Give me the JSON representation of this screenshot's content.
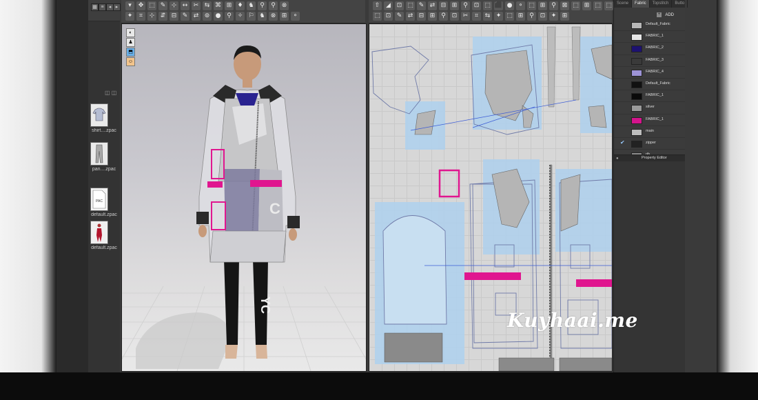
{
  "library": {
    "items": [
      {
        "label": "shirt....zpac",
        "icon": "shirt-thumbnail-icon"
      },
      {
        "label": "pan....zpac",
        "icon": "pants-thumbnail-icon"
      },
      {
        "label": "default.zpac",
        "icon": "document-thumbnail-icon",
        "badge": "PAC"
      },
      {
        "label": "default.zpac",
        "icon": "avatar-thumbnail-icon"
      }
    ]
  },
  "toolbar3d": {
    "row1": [
      "▾",
      "✥",
      "⬚",
      "✎",
      "⊹",
      "↔",
      "✂",
      "⇆",
      "⌘",
      "⊞",
      "♦",
      "♞",
      "⚲",
      "⚲",
      "⊗"
    ],
    "row2": [
      "✦",
      "⌗",
      "⊹",
      "⇵",
      "⊟",
      "✎",
      "⇄",
      "⊚",
      "●",
      "⚲",
      "✧",
      "⚐",
      "♞",
      "⊗",
      "⊞",
      "⚬"
    ]
  },
  "toolbar2d": {
    "row1": [
      "⇧",
      "◢",
      "⊡",
      "⬚",
      "✎",
      "⇄",
      "⊟",
      "⊞",
      "⚲",
      "⊡",
      "⬚",
      "⬛",
      "●",
      "⚬",
      "⬚",
      "⊞",
      "⚲",
      "⊠",
      "⬚",
      "⊞",
      "⬚",
      "⬚"
    ],
    "row2": [
      "⬚",
      "⊡",
      "✎",
      "⇄",
      "⊟",
      "⊞",
      "⚲",
      "⊡",
      "✂",
      "⌗",
      "⇆",
      "✦",
      "⬚",
      "⊞",
      "⚲",
      "⊡",
      "✦",
      "⊞"
    ]
  },
  "viewport3d_tools": [
    "◐",
    "♟",
    "⬒",
    "☺"
  ],
  "fabric_panel": {
    "tabs": [
      "Scene",
      "Fabric",
      "Topstitch",
      "Butto"
    ],
    "active_tab": "Fabric",
    "add_label": "ADD",
    "fabrics": [
      {
        "name": "Default_Fabric",
        "color": "#b8b8b8"
      },
      {
        "name": "FABRIC_1",
        "color": "#e6e6e6"
      },
      {
        "name": "FABRIC_2",
        "color": "#1d1270"
      },
      {
        "name": "FABRIC_3",
        "color": "#3a3a3a"
      },
      {
        "name": "FABRIC_4",
        "color": "#9d93d6"
      },
      {
        "name": "Default_Fabric",
        "color": "#111111"
      },
      {
        "name": "FABRIC_1",
        "color": "#0a0a0a"
      },
      {
        "name": "silver",
        "color": "#9a9a9a"
      },
      {
        "name": "FABRIC_1",
        "color": "#d4148c"
      },
      {
        "name": "main",
        "color": "#bdbdbd"
      },
      {
        "name": "zipper",
        "color": "#222222"
      },
      {
        "name": "rib",
        "color": "#8c8c8c"
      }
    ],
    "checked_index": 10,
    "property_editor_label": "Property Editor"
  },
  "watermark": "Kuyhaai.me",
  "colors": {
    "accent_pink": "#e0168f",
    "pattern_blue": "#aed1ee",
    "silver": "#b5b5b5"
  }
}
